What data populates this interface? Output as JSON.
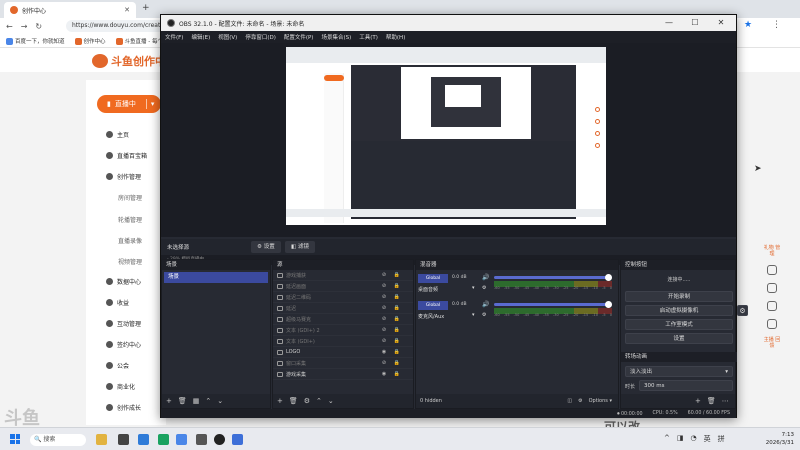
{
  "browser": {
    "tab_title": "创作中心",
    "url": "https://www.douyu.com/creator",
    "bookmarks": [
      "百度一下，你就知道",
      "创作中心",
      "斗鱼直播 - 每个..."
    ]
  },
  "site": {
    "logo": "斗鱼创作中心",
    "live_button": "直播中",
    "nav": [
      {
        "label": "主页",
        "sub": false
      },
      {
        "label": "直播百宝箱",
        "sub": false
      },
      {
        "label": "创作管理",
        "sub": false
      },
      {
        "label": "房间管理",
        "sub": true
      },
      {
        "label": "轮播管理",
        "sub": true
      },
      {
        "label": "直播录像",
        "sub": true
      },
      {
        "label": "视频管理",
        "sub": true
      },
      {
        "label": "数据中心",
        "sub": false
      },
      {
        "label": "收益",
        "sub": false
      },
      {
        "label": "互动管理",
        "sub": false
      },
      {
        "label": "签约中心",
        "sub": false
      },
      {
        "label": "公会",
        "sub": false
      },
      {
        "label": "商业化",
        "sub": false
      },
      {
        "label": "创作成长",
        "sub": false
      }
    ],
    "right_rail_top": "礼物 管理",
    "right_rail_bottom": "主播 回馈",
    "watermark_left": "斗鱼",
    "watermark_right": "可以改"
  },
  "obs": {
    "title": "OBS 32.1.0 - 配置文件: 未命名 - 场景: 未命名",
    "menu": [
      "文件(F)",
      "编辑(E)",
      "视图(V)",
      "停靠窗口(D)",
      "配置文件(P)",
      "场景集合(S)",
      "工具(T)",
      "帮助(H)"
    ],
    "preview_bar": "- 29%    模拟直播中",
    "context": {
      "no_source": "未选择源",
      "properties": "设置",
      "filters": "滤镜"
    },
    "scenes": {
      "title": "场景",
      "items": [
        "场景"
      ]
    },
    "sources": {
      "title": "源",
      "items": [
        {
          "name": "游戏捕获",
          "visible": false
        },
        {
          "name": "延迟画面",
          "visible": false
        },
        {
          "name": "延迟二维码",
          "visible": false
        },
        {
          "name": "延迟",
          "visible": false
        },
        {
          "name": "超级马赛克",
          "visible": false
        },
        {
          "name": "文本 (GDI+) 2",
          "visible": false
        },
        {
          "name": "文本 (GDI+)",
          "visible": false
        },
        {
          "name": "LOGO",
          "visible": true
        },
        {
          "name": "窗口采集",
          "visible": false
        },
        {
          "name": "游戏采集",
          "visible": true
        }
      ]
    },
    "mixer": {
      "title": "混音器",
      "channels": [
        {
          "tag": "Global",
          "db": "0.0 dB",
          "name": "桌面音频"
        },
        {
          "tag": "Global",
          "db": "0.0 dB",
          "name": "麦克风/Aux"
        }
      ],
      "scale": [
        "-60",
        "-55",
        "-50",
        "-45",
        "-40",
        "-35",
        "-30",
        "-25",
        "-20",
        "-15",
        "-10",
        "-5",
        "0"
      ],
      "hidden": "0 hidden",
      "options": "Options"
    },
    "controls": {
      "title": "控制按钮",
      "status": "连接中.....",
      "start_record": "开始录制",
      "virtual_cam": "启动虚拟摄像机",
      "studio_mode": "工作室模式",
      "settings": "设置"
    },
    "transitions": {
      "title": "转场动画",
      "type": "淡入淡出",
      "duration_label": "时长",
      "duration": "300 ms"
    },
    "status": {
      "rec_time": "00:00:00",
      "cpu": "CPU: 0.5%",
      "fps": "60.00 / 60.00 FPS"
    }
  },
  "taskbar": {
    "search": "搜索",
    "tray": [
      "^",
      "英",
      "拼"
    ],
    "time": "7:13",
    "date": "2026/3/31"
  }
}
